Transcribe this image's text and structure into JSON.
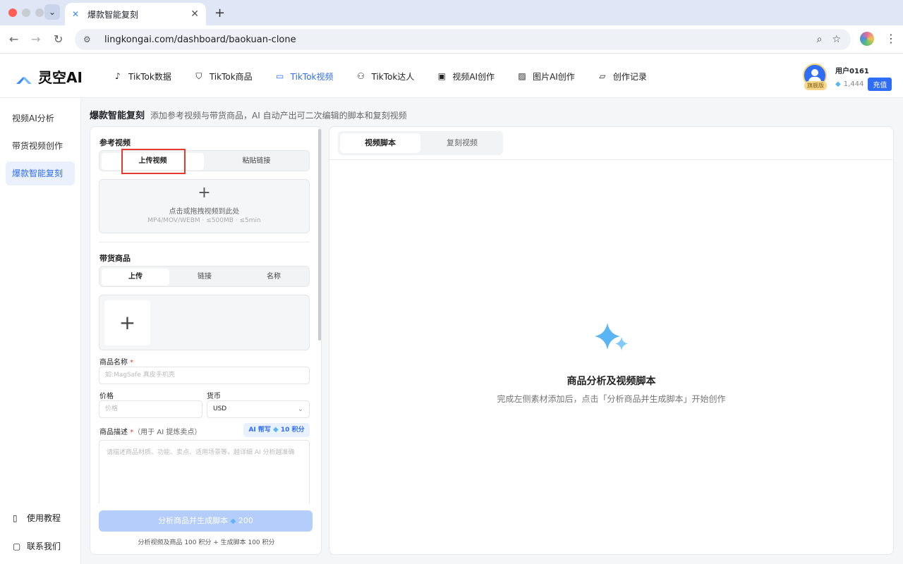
{
  "browser": {
    "tab_title": "爆款智能复刻",
    "url": "lingkongai.com/dashboard/baokuan-clone"
  },
  "brand": {
    "name": "灵空AI",
    "accent": "#2f6df6"
  },
  "nav": [
    {
      "label": "TikTok数据",
      "icon": "tiktok-icon"
    },
    {
      "label": "TikTok商品",
      "icon": "bag-icon"
    },
    {
      "label": "TikTok视频",
      "icon": "video-icon",
      "active": true
    },
    {
      "label": "TikTok达人",
      "icon": "users-icon"
    },
    {
      "label": "视频AI创作",
      "icon": "film-icon"
    },
    {
      "label": "图片AI创作",
      "icon": "image-icon"
    },
    {
      "label": "创作记录",
      "icon": "folder-icon"
    }
  ],
  "user": {
    "name": "用户0161",
    "tier": "旗舰版",
    "credits": "1,444",
    "recharge": "充值"
  },
  "sidebar": {
    "items": [
      {
        "label": "视频AI分析"
      },
      {
        "label": "带货视频创作"
      },
      {
        "label": "爆款智能复刻",
        "active": true
      }
    ],
    "footer": [
      {
        "label": "使用教程",
        "icon": "book-icon"
      },
      {
        "label": "联系我们",
        "icon": "chat-icon"
      }
    ]
  },
  "page": {
    "title": "爆款智能复刻",
    "subtitle": "添加参考视频与带货商品，AI 自动产出可二次编辑的脚本和复刻视频"
  },
  "form": {
    "ref_video_label": "参考视频",
    "ref_tabs": [
      "上传视频",
      "粘贴链接"
    ],
    "drop_main": "点击或拖拽视频到此处",
    "drop_hint": "MP4/MOV/WEBM · ≤500MB · ≤5min",
    "product_label": "带货商品",
    "product_tabs": [
      "上传",
      "链接",
      "名称"
    ],
    "name_label": "商品名称",
    "name_placeholder": "如:MagSafe 真皮手机壳",
    "price_label": "价格",
    "price_placeholder": "价格",
    "currency_label": "货币",
    "currency_value": "USD",
    "desc_label": "商品描述",
    "desc_sub": "（用于 AI 提炼卖点）",
    "ai_write": "AI 帮写",
    "ai_cost": "10 积分",
    "desc_placeholder": "请描述商品材质、功能、卖点、适用场景等，越详细 AI 分析越准确",
    "submit_label": "分析商品并生成脚本",
    "submit_cost": "200",
    "cost_note": "分析视频及商品 100 积分 + 生成脚本 100 积分"
  },
  "result": {
    "tabs": [
      "视频脚本",
      "复刻视频"
    ],
    "empty_title": "商品分析及视频脚本",
    "empty_desc": "完成左侧素材添加后，点击「分析商品并生成脚本」开始创作"
  }
}
